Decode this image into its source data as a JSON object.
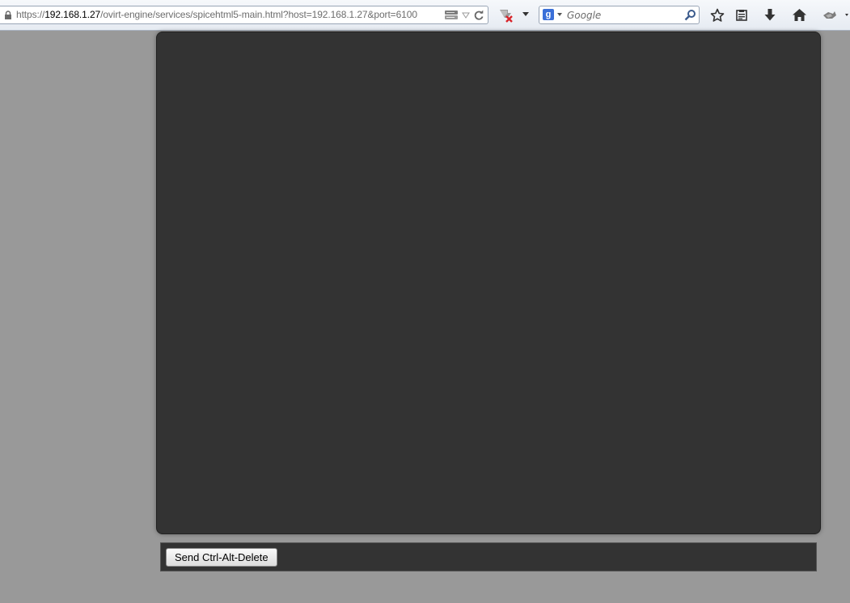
{
  "browser": {
    "url_prefix": "https://",
    "url_host": "192.168.1.27",
    "url_path": "/ovirt-engine/services/spicehtml5-main.html?host=192.168.1.27&port=6100",
    "search_placeholder": "Google",
    "search_engine_letter": "g"
  },
  "icons": {
    "lock": "lock-icon",
    "site_identity": "network-icon",
    "history_dropdown": "dropdown-arrow-icon",
    "reload": "reload-icon",
    "addon": "addon-blocked-icon",
    "bookmark": "star-icon",
    "bookmarks_list": "bookmarks-list-icon",
    "downloads": "download-icon",
    "home": "home-icon",
    "extension": "extension-icon"
  },
  "spice": {
    "send_cad_label": "Send Ctrl-Alt-Delete"
  },
  "colors": {
    "page_background": "#999999",
    "screen_background": "#333333"
  }
}
